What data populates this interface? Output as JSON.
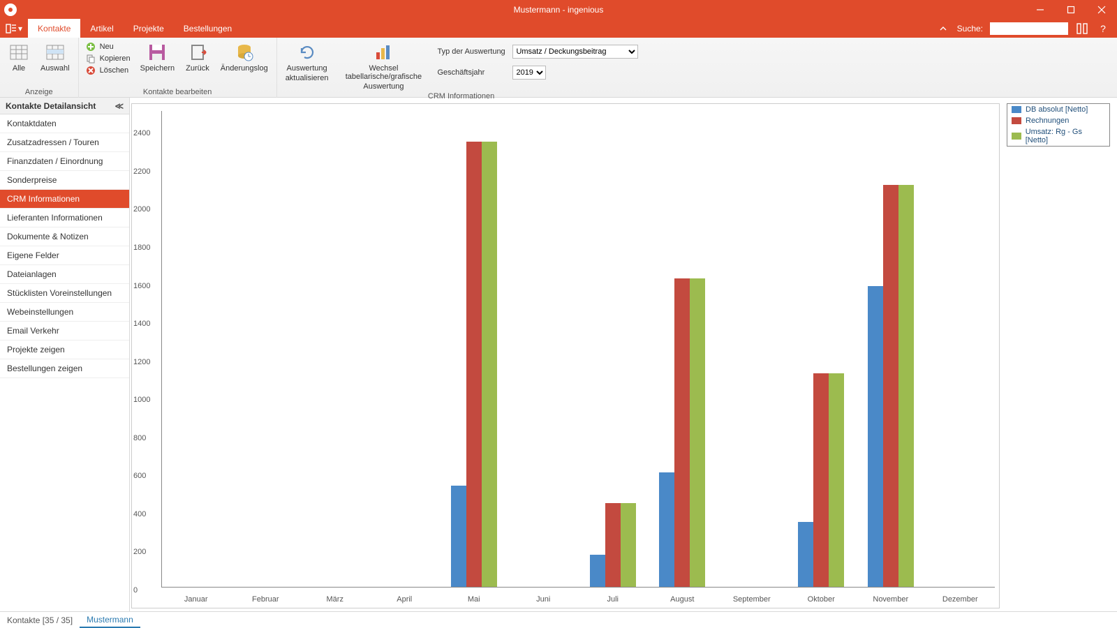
{
  "window": {
    "title": "Mustermann - ingenious"
  },
  "menu": {
    "tabs": [
      "Kontakte",
      "Artikel",
      "Projekte",
      "Bestellungen"
    ],
    "active_tab_index": 0,
    "search_label": "Suche:",
    "search_value": ""
  },
  "ribbon": {
    "groups": {
      "anzeige": {
        "label": "Anzeige",
        "alle": "Alle",
        "auswahl": "Auswahl"
      },
      "kontakte_bearbeiten": {
        "label": "Kontakte bearbeiten",
        "neu": "Neu",
        "kopieren": "Kopieren",
        "loeschen": "Löschen",
        "speichern": "Speichern",
        "zurueck": "Zurück",
        "aenderungslog": "Änderungslog"
      },
      "crm": {
        "label": "CRM Informationen",
        "auswertung_aktualisieren_l1": "Auswertung",
        "auswertung_aktualisieren_l2": "aktualisieren",
        "wechsel_l1": "Wechsel tabellarische/grafische",
        "wechsel_l2": "Auswertung",
        "typ_label": "Typ der Auswertung",
        "typ_value": "Umsatz / Deckungsbeitrag",
        "jahr_label": "Geschäftsjahr",
        "jahr_value": "2019"
      }
    }
  },
  "sidepanel": {
    "title": "Kontakte Detailansicht",
    "items": [
      "Kontaktdaten",
      "Zusatzadressen / Touren",
      "Finanzdaten / Einordnung",
      "Sonderpreise",
      "CRM Informationen",
      "Lieferanten Informationen",
      "Dokumente & Notizen",
      "Eigene Felder",
      "Dateianlagen",
      "Stücklisten Voreinstellungen",
      "Webeinstellungen",
      "Email Verkehr",
      "Projekte zeigen",
      "Bestellungen zeigen"
    ],
    "active_index": 4
  },
  "chart_data": {
    "type": "bar",
    "categories": [
      "Januar",
      "Februar",
      "März",
      "April",
      "Mai",
      "Juni",
      "Juli",
      "August",
      "September",
      "Oktober",
      "November",
      "Dezember"
    ],
    "series": [
      {
        "name": "DB absolut [Netto]",
        "color": "#4a89c8",
        "values": [
          0,
          0,
          0,
          0,
          530,
          0,
          170,
          600,
          0,
          340,
          1580,
          0
        ]
      },
      {
        "name": "Rechnungen",
        "color": "#c34a3f",
        "values": [
          0,
          0,
          0,
          0,
          2340,
          0,
          440,
          1620,
          0,
          1120,
          2110,
          0
        ]
      },
      {
        "name": "Umsatz: Rg - Gs [Netto]",
        "color": "#9cbb4f",
        "values": [
          0,
          0,
          0,
          0,
          2340,
          0,
          440,
          1620,
          0,
          1120,
          2110,
          0
        ]
      }
    ],
    "ylim": [
      0,
      2500
    ],
    "yticks": [
      0,
      200,
      400,
      600,
      800,
      1000,
      1200,
      1400,
      1600,
      1800,
      2000,
      2200,
      2400
    ]
  },
  "status": {
    "tabs": [
      "Kontakte [35 / 35]",
      "Mustermann"
    ],
    "active_index": 1
  },
  "colors": {
    "primary": "#e04b2b"
  }
}
